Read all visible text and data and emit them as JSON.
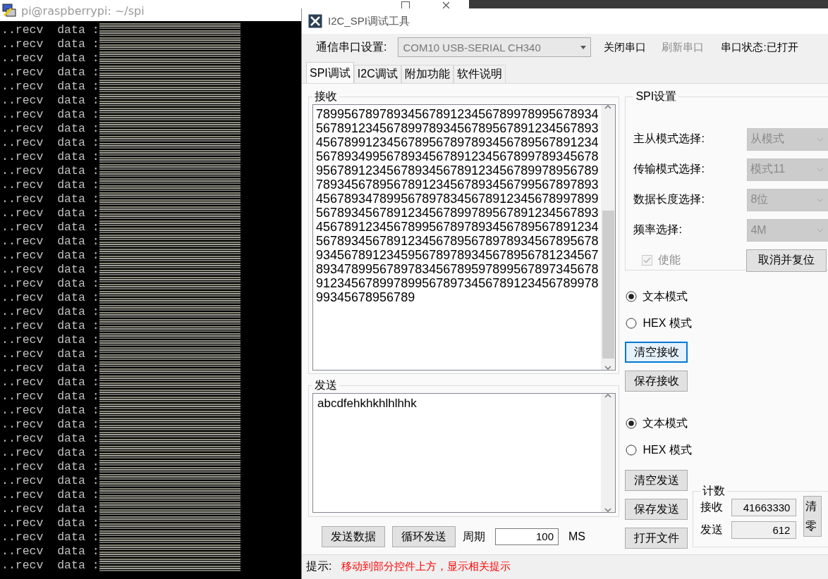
{
  "terminal": {
    "title": "pi@raspberrypi: ~/spi",
    "lines": [
      "..recv  data :",
      "..recv  data :",
      "..recv  data :",
      "..recv  data :",
      "..recv  data :",
      "..recv  data :",
      "..recv  data :",
      "..recv  data :",
      "..recv  data :",
      "..recv  data :",
      "..recv  data :",
      "..recv  data :",
      "..recv  data :",
      "..recv  data :",
      "..recv  data :",
      "..recv  data :",
      "..recv  data :",
      "..recv  data :",
      "..recv  data :",
      "..recv  data :",
      "..recv  data :",
      "..recv  data :",
      "..recv  data :",
      "..recv  data :",
      "..recv  data :",
      "..recv  data :",
      "..recv  data :",
      "..recv  data :",
      "..recv  data :",
      "..recv  data :",
      "..recv  data :",
      "..recv  data :",
      "..recv  data :",
      "..recv  data :",
      "..recv  data :",
      "..recv  data :",
      "..recv  data :",
      "..recv  data :",
      "..recv  data :"
    ]
  },
  "tool_window": {
    "title": "I2C_SPI调试工具",
    "port_bar": {
      "label": "通信串口设置:",
      "port": "COM10 USB-SERIAL CH340",
      "port_disabled": true,
      "buttons": [
        {
          "label": "关闭串口",
          "disabled": false
        },
        {
          "label": "刷新串口",
          "disabled": true
        }
      ],
      "status": "串口状态:已打开"
    },
    "tabs": [
      {
        "label": "SPI调试",
        "selected": true
      },
      {
        "label": "I2C调试",
        "selected": false
      },
      {
        "label": "附加功能",
        "selected": false
      },
      {
        "label": "软件说明",
        "selected": false
      }
    ],
    "receive": {
      "title": "接收",
      "lines": [
        "7899567897893456789123456789978995678934",
        "5678912345678997893456789567891234567893",
        "4567899123456789567897893456789567891234",
        "5678934995678934567891234567899789345678",
        "9567891234567893456789123456789978956789",
        "7893456789567891234567893456799567897893",
        "4567893478995678978345678912345678997899",
        "5678934567891234567899789567891234567893",
        "4567891234567899567897893456789567891234",
        "5678934567891234567895678978934567895678",
        "9345678912345956789789345678956781234567",
        "8934789956789783456789597899567897345678",
        "9123456789978995678973456789123456789978",
        "99345678956789"
      ]
    },
    "send": {
      "title": "发送",
      "value": "abcdfehkhkhlhlhhk"
    },
    "send_controls": {
      "buttons": [
        "发送数据",
        "循环发送"
      ],
      "period_label": "周期",
      "period": "100",
      "unit": "MS"
    },
    "spi_settings": {
      "title": "SPI设置",
      "fields": [
        {
          "label": "主从模式选择:",
          "value": "从模式",
          "disabled": true
        },
        {
          "label": "传输模式选择:",
          "value": "模式11",
          "disabled": true
        },
        {
          "label": "数据长度选择:",
          "value": "8位",
          "disabled": true
        },
        {
          "label": "频率选择:",
          "value": "4M",
          "disabled": true
        }
      ],
      "enable": {
        "label": "使能",
        "checked": true,
        "disabled": true
      },
      "reset_button": "取消并复位"
    },
    "receive_mode": {
      "options": [
        {
          "label": "文本模式",
          "selected": true
        },
        {
          "label": "HEX 模式",
          "selected": false
        }
      ],
      "buttons": [
        {
          "label": "清空接收",
          "focused": true
        },
        {
          "label": "保存接收",
          "focused": false
        }
      ]
    },
    "send_mode": {
      "options": [
        {
          "label": "文本模式",
          "selected": true
        },
        {
          "label": "HEX 模式",
          "selected": false
        }
      ],
      "buttons": [
        {
          "label": "清空发送",
          "focused": false
        },
        {
          "label": "保存发送",
          "focused": false
        },
        {
          "label": "打开文件",
          "focused": false
        }
      ]
    },
    "counter": {
      "title": "计数",
      "rows": [
        {
          "label": "接收",
          "value": "41663330"
        },
        {
          "label": "发送",
          "value": "612"
        }
      ],
      "clear_button": "清零"
    },
    "status_bar": {
      "label": "提示:",
      "message": "移动到部分控件上方，显示相关提示"
    }
  }
}
